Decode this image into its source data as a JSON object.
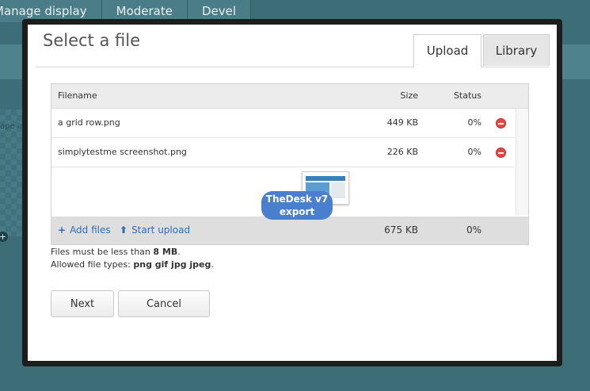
{
  "background": {
    "tabs": [
      "Manage display",
      "Moderate",
      "Devel"
    ],
    "side_text": "ape im"
  },
  "dialog": {
    "title": "Select a file",
    "tabs": [
      {
        "label": "Upload",
        "active": true
      },
      {
        "label": "Library",
        "active": false
      }
    ]
  },
  "filelist": {
    "headers": {
      "name": "Filename",
      "size": "Size",
      "status": "Status"
    },
    "rows": [
      {
        "name": "a grid row.png",
        "size": "449 KB",
        "status": "0%"
      },
      {
        "name": "simplytestme screenshot.png",
        "size": "226 KB",
        "status": "0%"
      }
    ],
    "footer": {
      "add_label": "Add files",
      "start_label": "Start upload",
      "total_size": "675 KB",
      "total_status": "0%"
    }
  },
  "watermark": {
    "line1": "TheDesk v7",
    "line2": "export"
  },
  "hints": {
    "size_prefix": "Files must be less than ",
    "size_value": "8 MB",
    "size_suffix": ".",
    "types_prefix": "Allowed file types: ",
    "types_value": "png gif jpg jpeg",
    "types_suffix": "."
  },
  "buttons": {
    "next": "Next",
    "cancel": "Cancel"
  },
  "icons": {
    "add": "plus-icon",
    "upload": "arrow-up-icon",
    "remove": "remove-icon"
  },
  "colors": {
    "link": "#2b6fb6",
    "remove": "#e04a43",
    "watermark": "#4a7fd0"
  }
}
